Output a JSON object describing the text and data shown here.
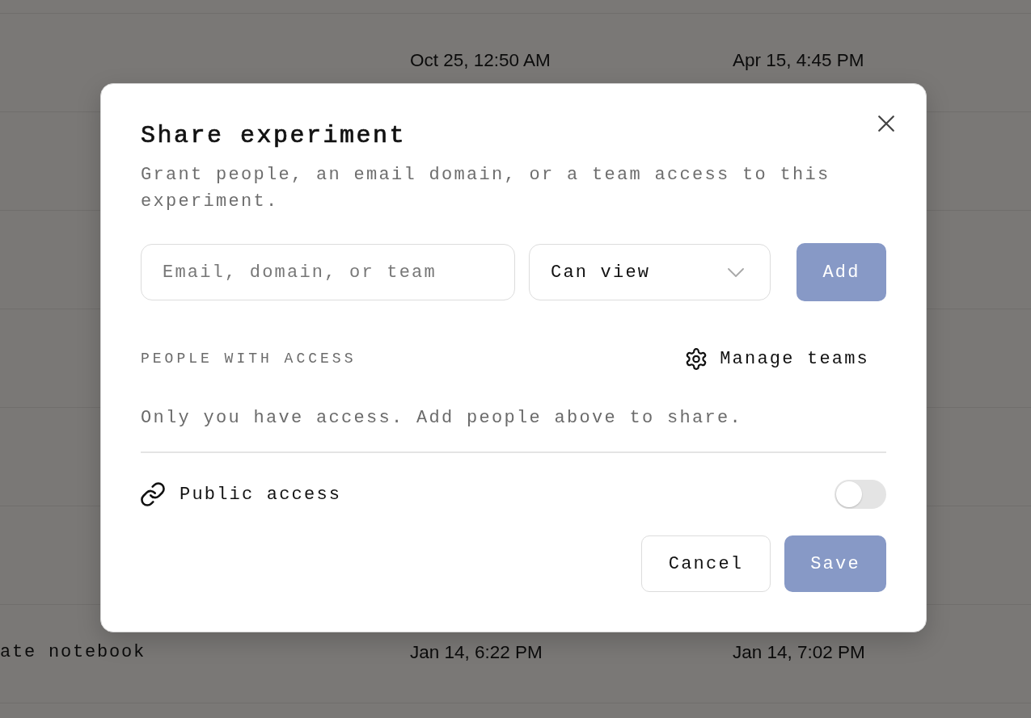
{
  "background_table": {
    "rows": [
      {
        "column_2": "Oct 25, 12:50 AM",
        "column_3": "Apr 15, 4:45 PM"
      },
      {
        "column_1": "ate notebook",
        "column_2": "Jan 14, 6:22 PM",
        "column_3": "Jan 14, 7:02 PM"
      }
    ]
  },
  "dialog": {
    "title": "Share experiment",
    "description": "Grant people, an email domain, or a team access to this experiment.",
    "invite": {
      "placeholder": "Email, domain, or team",
      "permission": "Can view",
      "add_button": {
        "label": "Add",
        "disabled": true
      }
    },
    "section_label": "PEOPLE WITH ACCESS",
    "manage_teams": "Manage teams",
    "empty_message": "Only you have access. Add people above to share.",
    "public_access": {
      "label": "Public access",
      "on": false
    },
    "buttons": [
      {
        "label": "Cancel",
        "kind": "secondary",
        "disabled": false
      },
      {
        "label": "Save",
        "kind": "primary",
        "disabled": true
      }
    ]
  }
}
